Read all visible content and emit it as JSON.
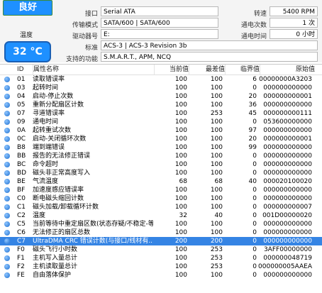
{
  "status": "良好",
  "temperature": {
    "label": "温度",
    "value": "32 °C"
  },
  "top_cut_text": "⋯⋯⋯⋯",
  "fields": {
    "interface_label": "接口",
    "interface_value": "Serial ATA",
    "transfer_label": "传输模式",
    "transfer_value": "SATA/600 | SATA/600",
    "drive_label": "驱动器号",
    "drive_value": "E:",
    "standard_label": "标准",
    "standard_value": "ACS-3 | ACS-3 Revision 3b",
    "features_label": "支持的功能",
    "features_value": "S.M.A.R.T., APM, NCQ",
    "rpm_label": "转速",
    "rpm_value": "5400 RPM",
    "power_count_label": "通电次数",
    "power_count_value": "1 次",
    "power_time_label": "通电时间",
    "power_time_value": "0 小时"
  },
  "table": {
    "headers": {
      "id": "ID",
      "name": "属性名称",
      "current": "当前值",
      "worst": "最差值",
      "threshold": "临界值",
      "raw": "原始值"
    },
    "rows": [
      {
        "id": "01",
        "name": "读取错误率",
        "current": "100",
        "worst": "100",
        "threshold": "6",
        "raw": "00000000A3203"
      },
      {
        "id": "03",
        "name": "起转时间",
        "current": "100",
        "worst": "100",
        "threshold": "0",
        "raw": "000000000000"
      },
      {
        "id": "04",
        "name": "启动-停止次数",
        "current": "100",
        "worst": "100",
        "threshold": "20",
        "raw": "000000000001"
      },
      {
        "id": "05",
        "name": "重新分配扇区计数",
        "current": "100",
        "worst": "100",
        "threshold": "36",
        "raw": "000000000000"
      },
      {
        "id": "07",
        "name": "寻道错误率",
        "current": "100",
        "worst": "253",
        "threshold": "45",
        "raw": "000000000111"
      },
      {
        "id": "09",
        "name": "通电时间",
        "current": "100",
        "worst": "100",
        "threshold": "0",
        "raw": "053600000000"
      },
      {
        "id": "0A",
        "name": "起转重试次数",
        "current": "100",
        "worst": "100",
        "threshold": "97",
        "raw": "000000000000"
      },
      {
        "id": "0C",
        "name": "启动-关闭循环次数",
        "current": "100",
        "worst": "100",
        "threshold": "20",
        "raw": "000000000001"
      },
      {
        "id": "B8",
        "name": "端到端错误",
        "current": "100",
        "worst": "100",
        "threshold": "99",
        "raw": "000000000000"
      },
      {
        "id": "BB",
        "name": "报告的无法修正错误",
        "current": "100",
        "worst": "100",
        "threshold": "0",
        "raw": "000000000000"
      },
      {
        "id": "BC",
        "name": "命令超时",
        "current": "100",
        "worst": "100",
        "threshold": "0",
        "raw": "000000000000"
      },
      {
        "id": "BD",
        "name": "磁头非正常高度写入",
        "current": "100",
        "worst": "100",
        "threshold": "0",
        "raw": "000000000000"
      },
      {
        "id": "BE",
        "name": "气流温度",
        "current": "68",
        "worst": "68",
        "threshold": "40",
        "raw": "000020100020"
      },
      {
        "id": "BF",
        "name": "加速度感应错误率",
        "current": "100",
        "worst": "100",
        "threshold": "0",
        "raw": "000000000000"
      },
      {
        "id": "C0",
        "name": "断电磁头缩回计数",
        "current": "100",
        "worst": "100",
        "threshold": "0",
        "raw": "000000000000"
      },
      {
        "id": "C1",
        "name": "磁头加载/卸载循环计数",
        "current": "100",
        "worst": "100",
        "threshold": "0",
        "raw": "000000000007"
      },
      {
        "id": "C2",
        "name": "温度",
        "current": "32",
        "worst": "40",
        "threshold": "0",
        "raw": "001D00000020"
      },
      {
        "id": "C5",
        "name": "当前等待中重定扇区数(状态存疑/不稳定-等待后...",
        "current": "100",
        "worst": "100",
        "threshold": "0",
        "raw": "000000000000"
      },
      {
        "id": "C6",
        "name": "无法修正的扇区总数",
        "current": "100",
        "worst": "100",
        "threshold": "0",
        "raw": "000000000000"
      },
      {
        "id": "C7",
        "name": "UltraDMA CRC 错误计数(与接口/线材有...",
        "current": "200",
        "worst": "200",
        "threshold": "0",
        "raw": "000000000000"
      },
      {
        "id": "F0",
        "name": "磁头飞行小时数",
        "current": "100",
        "worst": "253",
        "threshold": "0",
        "raw": "3AFF00000000"
      },
      {
        "id": "F1",
        "name": "主机写入量总计",
        "current": "100",
        "worst": "253",
        "threshold": "0",
        "raw": "000000048719"
      },
      {
        "id": "F2",
        "name": "主机读取量总计",
        "current": "100",
        "worst": "253",
        "threshold": "0",
        "raw": "000000005AAEA"
      },
      {
        "id": "FE",
        "name": "自由落体保护",
        "current": "100",
        "worst": "100",
        "threshold": "0",
        "raw": "000000000000"
      }
    ]
  },
  "selected_row_id": "C7",
  "colors": {
    "accent": "#1e90ff",
    "selection": "#3584e4"
  }
}
